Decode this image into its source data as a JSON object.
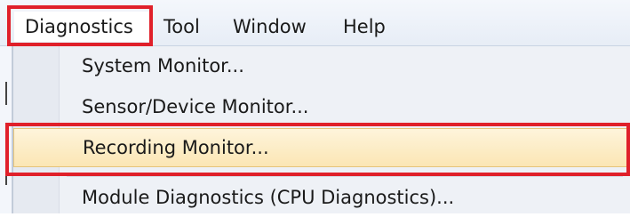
{
  "menubar": {
    "items": [
      {
        "label": "Diagnostics"
      },
      {
        "label": "Tool"
      },
      {
        "label": "Window"
      },
      {
        "label": "Help"
      }
    ]
  },
  "dropdown": {
    "items": [
      {
        "label": "System Monitor..."
      },
      {
        "label": "Sensor/Device Monitor..."
      },
      {
        "label": "Recording Monitor..."
      },
      {
        "label": "Module Diagnostics (CPU Diagnostics)..."
      }
    ],
    "selected_index": 2
  },
  "colors": {
    "highlight_box": "#e0202a",
    "selected_item_bg": "#fbe6b4",
    "menu_bg": "#eef1f6"
  }
}
